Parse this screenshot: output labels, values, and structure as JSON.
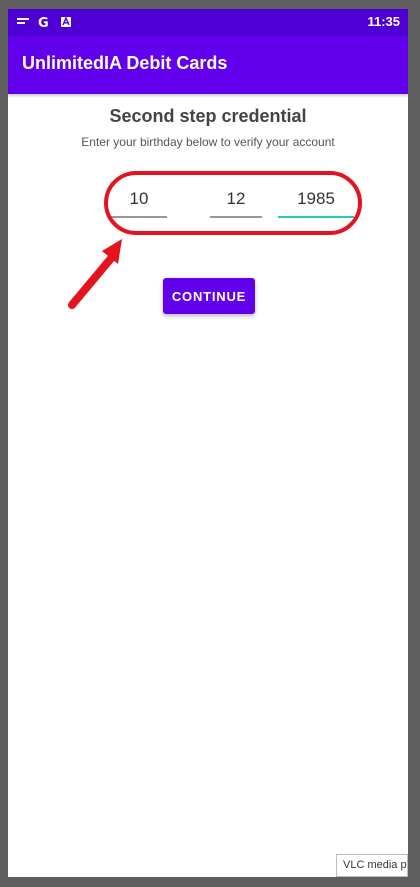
{
  "status_bar": {
    "time": "11:35",
    "icons": [
      "notification-icon",
      "google-icon",
      "app-icon"
    ]
  },
  "app_bar": {
    "title": "UnlimitedIA Debit Cards"
  },
  "credential": {
    "title": "Second step credential",
    "subtitle": "Enter your birthday below to verify your account",
    "day": "10",
    "month": "12",
    "year": "1985"
  },
  "actions": {
    "continue_label": "CONTINUE"
  },
  "tooltip": {
    "text": "VLC media p"
  },
  "colors": {
    "primary": "#6200ee",
    "primary_dark": "#4e00d4",
    "accent": "#1fcdbf",
    "annotation": "#e3141f"
  }
}
